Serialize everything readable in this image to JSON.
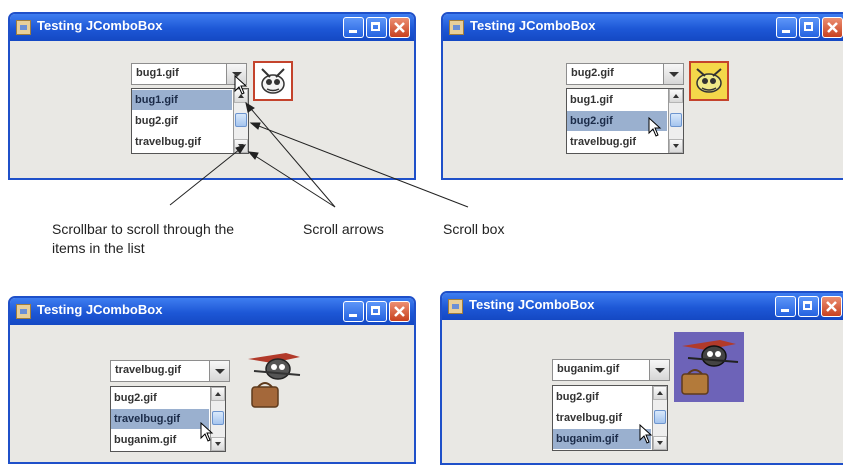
{
  "windows": [
    {
      "title": "Testing JComboBox",
      "selected": "bug1.gif",
      "items": [
        "bug1.gif",
        "bug2.gif",
        "travelbug.gif"
      ],
      "highlight": 0
    },
    {
      "title": "Testing JComboBox",
      "selected": "bug2.gif",
      "items": [
        "bug1.gif",
        "bug2.gif",
        "travelbug.gif"
      ],
      "highlight": 1
    },
    {
      "title": "Testing JComboBox",
      "selected": "travelbug.gif",
      "items": [
        "bug2.gif",
        "travelbug.gif",
        "buganim.gif"
      ],
      "highlight": 1
    },
    {
      "title": "Testing JComboBox",
      "selected": "buganim.gif",
      "items": [
        "bug2.gif",
        "travelbug.gif",
        "buganim.gif"
      ],
      "highlight": 2
    }
  ],
  "callouts": {
    "scrollbar": "Scrollbar to scroll through the items in the list",
    "scroll_arrows": "Scroll arrows",
    "scroll_box": "Scroll box"
  },
  "icons": {
    "app": "java-app-icon",
    "minimize": "minimize-icon",
    "maximize": "maximize-icon",
    "close": "close-icon",
    "bug": "bug-image"
  },
  "colors": {
    "title_bar": "#1f50c9",
    "close": "#c8411f",
    "selection": "#9ab0cf",
    "window_bg": "#e9e8e4"
  }
}
